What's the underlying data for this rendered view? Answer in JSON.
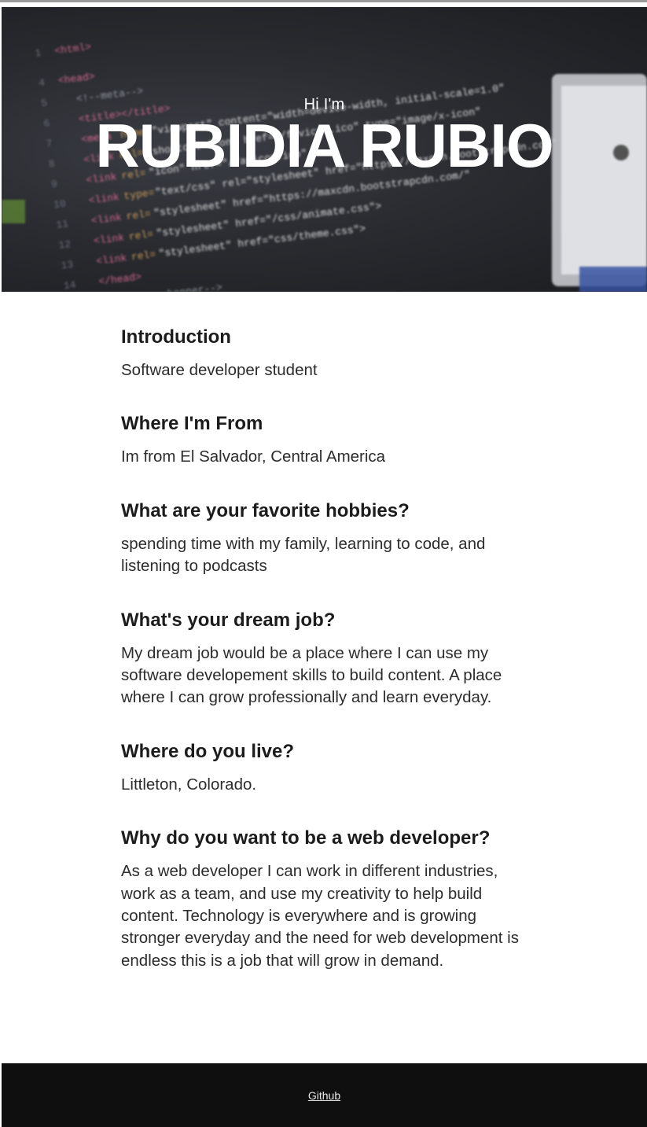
{
  "hero": {
    "greeting": "Hi I'm",
    "name": "RUBIDIA RUBIO"
  },
  "sections": [
    {
      "heading": "Introduction",
      "body": "Software developer student"
    },
    {
      "heading": "Where I'm From",
      "body": "Im from El Salvador, Central America"
    },
    {
      "heading": "What are your favorite hobbies?",
      "body": "spending time with my family, learning to code, and listening to podcasts"
    },
    {
      "heading": "What's your dream job?",
      "body": "My dream job would be a place where I can use my software developement skills to build content. A place where I can grow professionally and learn everyday."
    },
    {
      "heading": "Where do you live?",
      "body": "Littleton, Colorado."
    },
    {
      "heading": "Why do you want to be a web developer?",
      "body": "As a web developer I can work in different industries, work as a team, and use my creativity to help build content. Technology is everywhere and is growing stronger everyday and the need for web development is endless this is a job that will grow in demand."
    }
  ],
  "footer": {
    "link_label": "Github"
  },
  "colors": {
    "hero_bg": "#2a2c31",
    "footer_bg": "#0f0f0f",
    "text": "#2c2c2c"
  }
}
